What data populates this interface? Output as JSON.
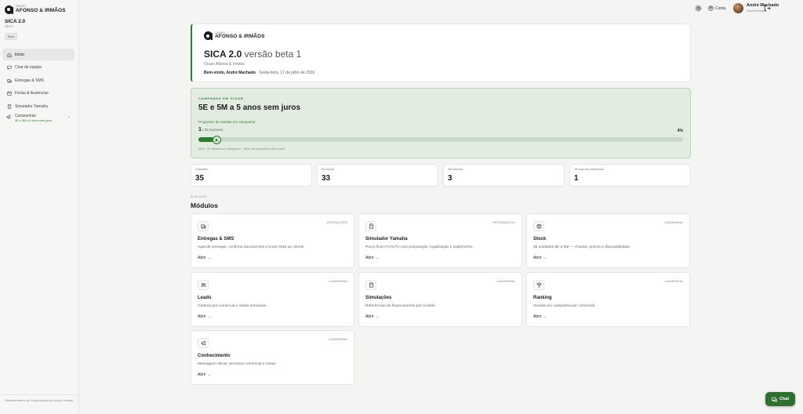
{
  "sidebar": {
    "logo_small": "GRUPO",
    "logo_big": "AFONSO & IRMÃOS",
    "app_title": "SICA 2.0",
    "app_sub": "SICA",
    "badge": "Beta",
    "items": [
      {
        "label": "Início",
        "icon": "home-icon"
      },
      {
        "label": "Chat de equipa",
        "icon": "chat-icon"
      },
      {
        "label": "Entregas & SMS",
        "icon": "truck-icon"
      },
      {
        "label": "Férias & Ausências",
        "icon": "calendar-icon"
      },
      {
        "label": "Simulador Yamaha",
        "icon": "calculator-icon"
      }
    ],
    "campaigns": {
      "label": "Campanhas",
      "sub": "5E e 5M a 5 anos sem juros"
    },
    "footer": "Sistema Interno de Comunicação do Afonso Irmãos"
  },
  "topbar": {
    "account_label": "Conta",
    "user_name": "André Machado",
    "user_role": "Administrador"
  },
  "hero": {
    "logo_small": "GRUPO",
    "logo_big": "AFONSO & IRMÃOS",
    "title": "SICA 2.0",
    "version": " versão beta 1",
    "group": "Grupo Afonso & Irmãos",
    "welcome": "Bem-vindo, André Machado",
    "date": " · Sexta-feira, 17 de julho de 2026"
  },
  "campaign": {
    "tag": "CAMPANHA EM VIGOR",
    "title": "5E e 5M a 5 anos sem juros",
    "progress_label": "Progresso de vendas em campanha",
    "count": "1",
    "total": " / 25 tractores",
    "percent_label": "4%",
    "progress": 0.04,
    "note": "96% · 22 vendas em campanha · 16ms do campanha está correrl"
  },
  "stats": [
    {
      "label": "Unidades",
      "value": "35"
    },
    {
      "label": "Em stock",
      "value": "33"
    },
    {
      "label": "Simulações",
      "value": "3"
    },
    {
      "label": "Vendas em campanha",
      "value": "1"
    }
  ],
  "modules_section": {
    "kicker": "ATALHOS",
    "title": "Módulos",
    "open_label": "Abrir →",
    "items": [
      {
        "tag": "OPERAÇÕES",
        "title": "Entregas & SMS",
        "desc": "Agende entregas, confirme documentos e envie SMS ao cliente.",
        "icon": "truck-icon"
      },
      {
        "tag": "FERRAMENTA",
        "title": "Simulador Yamaha",
        "desc": "Preço final ATV/UTV com preparação, legalização e suplemento.",
        "icon": "calculator-icon"
      },
      {
        "tag": "CAMPANHA",
        "title": "Stock",
        "desc": "36 unidades 5E a 5M — chassis, preços e disponibilidade.",
        "icon": "box-icon"
      },
      {
        "tag": "CAMPANHA",
        "title": "Leads",
        "desc": "Carteira por comercial e metas semanais.",
        "icon": "users-icon"
      },
      {
        "tag": "CAMPANHA",
        "title": "Simulações",
        "desc": "Referências de financiamento por modelo.",
        "icon": "calculator-icon"
      },
      {
        "tag": "CAMPANHA",
        "title": "Ranking",
        "desc": "Vendas em campanha por comercial.",
        "icon": "trophy-icon"
      },
      {
        "tag": "CAMPANHA",
        "title": "Conhecimento",
        "desc": "Mensagem oficial, processo comercial e metas.",
        "icon": "megaphone-icon"
      }
    ]
  },
  "chat_button": "Chat",
  "colors": {
    "accent": "#2e7d32",
    "campaign_bg": "#e2ece1"
  }
}
